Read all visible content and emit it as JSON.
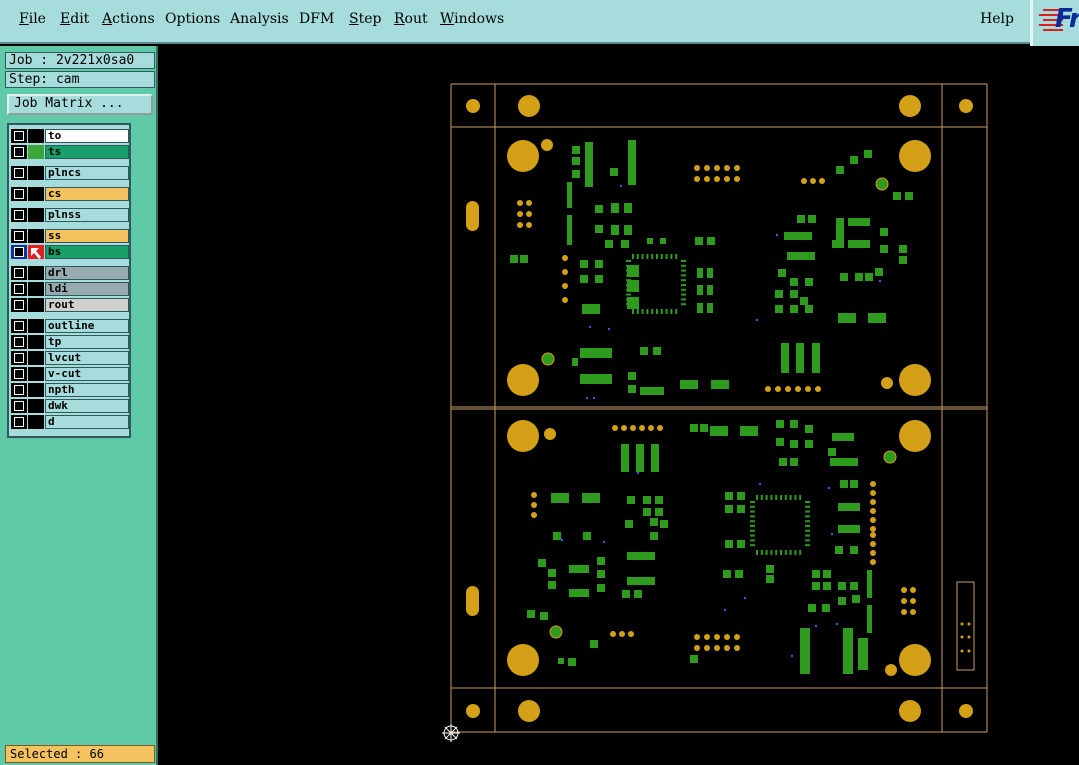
{
  "menu": {
    "items": [
      {
        "label": "File",
        "u": "F",
        "rest": "ile"
      },
      {
        "label": "Edit",
        "u": "E",
        "rest": "dit"
      },
      {
        "label": "Actions",
        "u": "A",
        "rest": "ctions"
      },
      {
        "label": "Options",
        "u": "",
        "rest": "Options"
      },
      {
        "label": "Analysis",
        "u": "",
        "rest": "Analysis"
      },
      {
        "label": "DFM",
        "u": "",
        "rest": "DFM"
      },
      {
        "label": "Step",
        "u": "S",
        "rest": "tep"
      },
      {
        "label": "Rout",
        "u": "R",
        "rest": "out"
      },
      {
        "label": "Windows",
        "u": "W",
        "rest": "indows"
      }
    ],
    "help": "Help",
    "logo": "Fr"
  },
  "job": "Job : 2v221x0sa0",
  "step": "Step: cam",
  "job_matrix": "Job Matrix ...",
  "layers": [
    {
      "name": "to",
      "bg": "#ffffff",
      "swatch": "#000000"
    },
    {
      "name": "ts",
      "bg": "#1a9e6a",
      "swatch": "#3aa63a"
    },
    {
      "name": "plncs",
      "bg": "#a6dcdc",
      "swatch": "#000000"
    },
    {
      "name": "cs",
      "bg": "#f4c360",
      "swatch": "#000000"
    },
    {
      "name": "plnss",
      "bg": "#a6dcdc",
      "swatch": "#000000"
    },
    {
      "name": "ss",
      "bg": "#f4c360",
      "swatch": "#000000"
    },
    {
      "name": "bs",
      "bg": "#1a9e6a",
      "swatch": "#e02020",
      "active": true
    },
    {
      "name": "drl",
      "bg": "#96aab0",
      "swatch": "#000000"
    },
    {
      "name": "ldi",
      "bg": "#96aab0",
      "swatch": "#000000"
    },
    {
      "name": "rout",
      "bg": "#d0d0d0",
      "swatch": "#000000"
    },
    {
      "name": "outline",
      "bg": "#a6dcdc",
      "swatch": "#000000"
    },
    {
      "name": "tp",
      "bg": "#a6dcdc",
      "swatch": "#000000"
    },
    {
      "name": "lvcut",
      "bg": "#a6dcdc",
      "swatch": "#000000"
    },
    {
      "name": "v-cut",
      "bg": "#a6dcdc",
      "swatch": "#000000"
    },
    {
      "name": "npth",
      "bg": "#a6dcdc",
      "swatch": "#000000"
    },
    {
      "name": "dwk",
      "bg": "#a6dcdc",
      "swatch": "#000000"
    },
    {
      "name": "d",
      "bg": "#a6dcdc",
      "swatch": "#000000"
    }
  ],
  "selected": "Selected : 66",
  "colors": {
    "board_outline": "#c8a060",
    "pad_gold": "#d4a017",
    "smd_green": "#2e9a1e",
    "background": "#000000"
  }
}
